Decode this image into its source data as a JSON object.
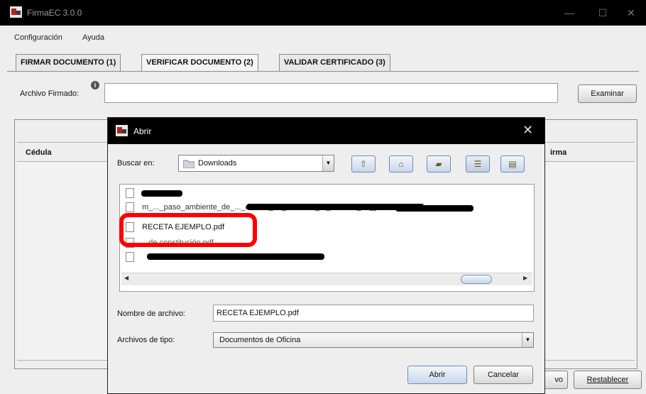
{
  "window": {
    "title": "FirmaEC 3.0.0",
    "controls": [
      "—",
      "☐",
      "✕"
    ]
  },
  "menu": {
    "items": [
      {
        "label": "Configuración",
        "mnemonic": "C"
      },
      {
        "label": "Ayuda",
        "mnemonic": "A"
      }
    ]
  },
  "tabs": [
    {
      "label": "FIRMAR DOCUMENTO (1)",
      "active": false
    },
    {
      "label": "VERIFICAR DOCUMENTO (2)",
      "active": true
    },
    {
      "label": "VALIDAR CERTIFICADO (3)",
      "active": false
    }
  ],
  "verify": {
    "file_label": "Archivo Firmado:",
    "file_value": "",
    "browse_label": "Examinar",
    "columns": {
      "cedula": "Cédula",
      "firma": "irma"
    },
    "bottom_partial_label": "vo",
    "reset_label": "Restablecer"
  },
  "dialog": {
    "title": "Abrir",
    "close": "✕",
    "look_in_label": "Buscar en:",
    "look_in_value": "Downloads",
    "toolbar_icons": [
      "up-folder-icon",
      "home-icon",
      "new-folder-icon",
      "list-view-icon",
      "details-view-icon"
    ],
    "files": [
      {
        "name": "",
        "redacted": true
      },
      {
        "name": "m_..._paso_ambiente_de_..._control_de_cambios_..._ficación_de_productos_pdf",
        "redacted": true
      },
      {
        "name": "RECETA EJEMPLO.pdf",
        "redacted": false,
        "highlighted": true
      },
      {
        "name": "...de constitución.pdf",
        "redacted": true
      },
      {
        "name": "",
        "redacted": true
      }
    ],
    "filename_label": "Nombre de archivo:",
    "filename_value": "RECETA EJEMPLO.pdf",
    "filetype_label": "Archivos de tipo:",
    "filetype_value": "Documentos de Oficina",
    "open_label": "Abrir",
    "cancel_label": "Cancelar"
  },
  "colors": {
    "titlebar": "#000000",
    "panel": "#eeeeee",
    "highlight": "#ff0000",
    "tool_button": "#c9d7ea"
  }
}
